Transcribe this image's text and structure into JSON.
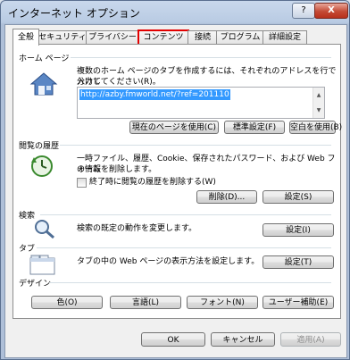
{
  "window": {
    "title": "インターネット オプション",
    "help": "?",
    "close": "X"
  },
  "tabs": [
    "全般",
    "セキュリティ",
    "プライバシー",
    "コンテンツ",
    "接続",
    "プログラム",
    "詳細設定"
  ],
  "home": {
    "heading": "ホーム ページ",
    "desc1": "複数のホーム ページのタブを作成するには、それぞれのアドレスを行で分けて",
    "desc2": "入力してください(R)。",
    "url": "http://azby.fmworld.net/?ref=201110",
    "btn_current": "現在のページを使用(C)",
    "btn_default": "標準設定(F)",
    "btn_blank": "空白を使用(B)"
  },
  "history": {
    "heading": "閲覧の履歴",
    "desc1": "一時ファイル、履歴、Cookie、保存されたパスワード、および Web フォーム",
    "desc2": "の情報を削除します。",
    "checkbox": "終了時に閲覧の履歴を削除する(W)",
    "btn_delete": "削除(D)...",
    "btn_settings": "設定(S)"
  },
  "search": {
    "heading": "検索",
    "desc": "検索の既定の動作を変更します。",
    "btn": "設定(I)"
  },
  "tabsec": {
    "heading": "タブ",
    "desc": "タブの中の Web ページの表示方法を設定します。",
    "btn": "設定(T)"
  },
  "design": {
    "heading": "デザイン",
    "btn_color": "色(O)",
    "btn_lang": "言語(L)",
    "btn_font": "フォント(N)",
    "btn_access": "ユーザー補助(E)"
  },
  "footer": {
    "ok": "OK",
    "cancel": "キャンセル",
    "apply": "適用(A)"
  }
}
